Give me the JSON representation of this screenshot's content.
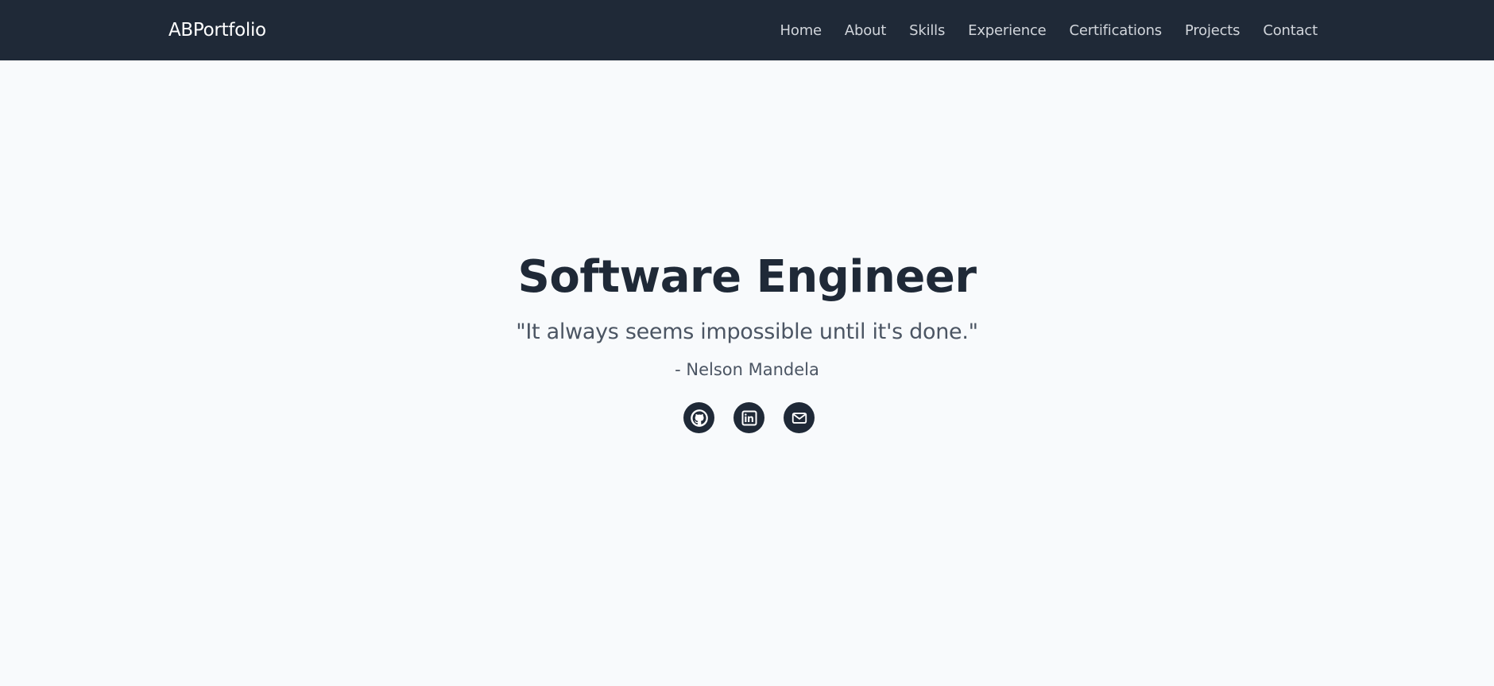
{
  "navbar": {
    "brand": "ABPortfolio",
    "links": [
      "Home",
      "About",
      "Skills",
      "Experience",
      "Certifications",
      "Projects",
      "Contact"
    ]
  },
  "hero": {
    "title": "Software Engineer",
    "quote": "\"It always seems impossible until it's done.\"",
    "author": "- Nelson Mandela"
  },
  "social": {
    "icons": [
      "github-icon",
      "linkedin-icon",
      "mail-icon"
    ]
  },
  "colors": {
    "navbar_bg": "#1f2937",
    "page_bg": "#f8fafc",
    "title": "#1f2937",
    "quote": "#4b5563",
    "nav_link": "#d1d5db"
  }
}
